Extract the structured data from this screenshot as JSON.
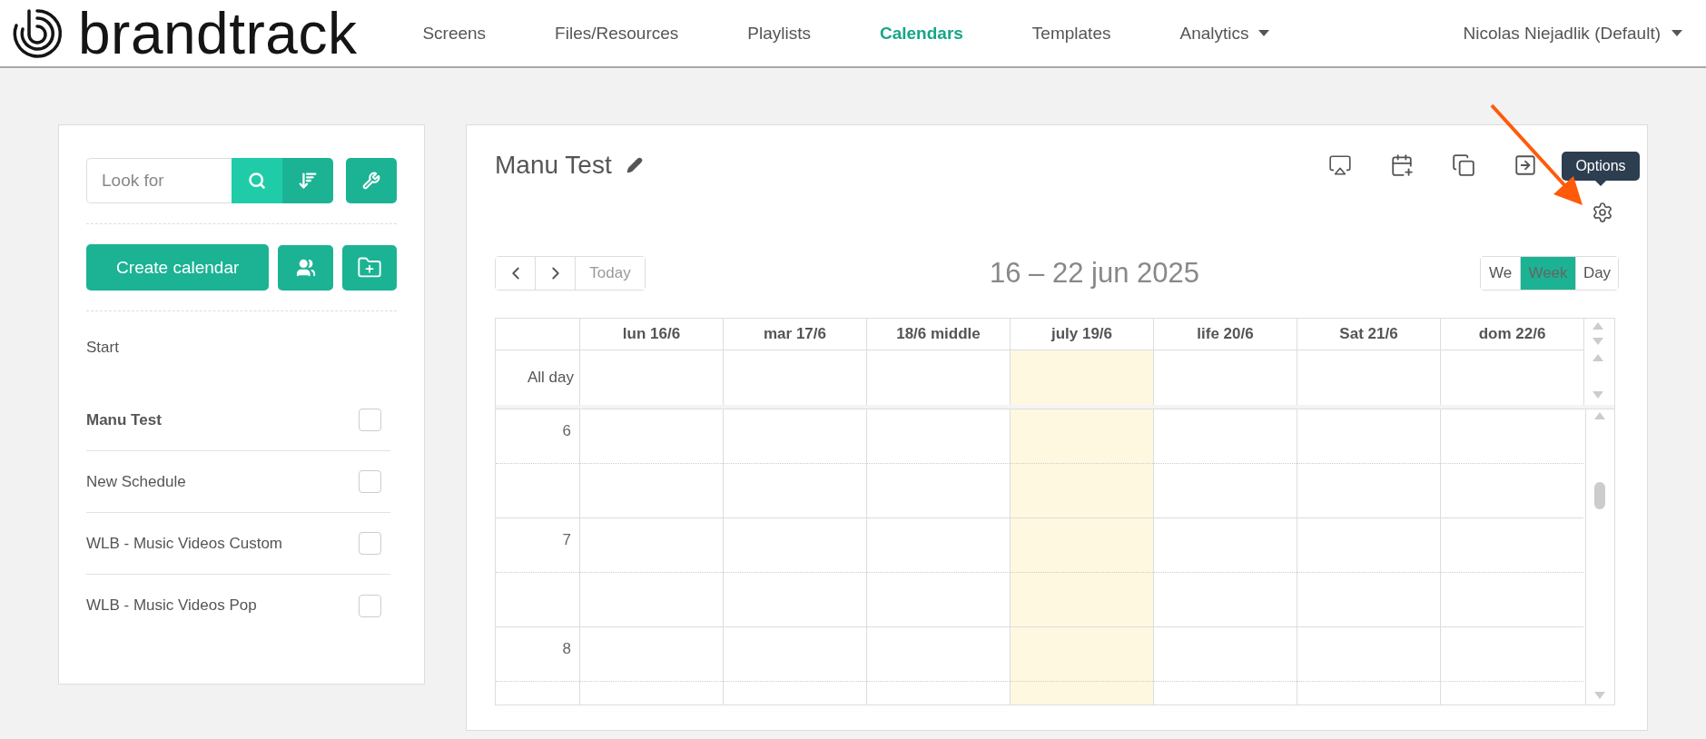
{
  "header": {
    "logo": "brandtrack",
    "nav": [
      {
        "label": "Screens",
        "selected": false,
        "kind": "link"
      },
      {
        "label": "Files/Resources",
        "selected": false,
        "kind": "link"
      },
      {
        "label": "Playlists",
        "selected": false,
        "kind": "link"
      },
      {
        "label": "Calendars",
        "selected": true,
        "kind": "link"
      },
      {
        "label": "Templates",
        "selected": false,
        "kind": "link"
      },
      {
        "label": "Analytics",
        "selected": false,
        "kind": "dropdown"
      }
    ],
    "user": "Nicolas Niejadlik (Default)"
  },
  "sidebar": {
    "search": {
      "placeholder": "Look for"
    },
    "create_button": "Create calendar",
    "section": "Start",
    "calendars": [
      {
        "name": "Manu Test",
        "selected": true,
        "checked": false
      },
      {
        "name": "New Schedule",
        "selected": false,
        "checked": false
      },
      {
        "name": "WLB - Music Videos Custom",
        "selected": false,
        "checked": false
      },
      {
        "name": "WLB - Music Videos Pop",
        "selected": false,
        "checked": false
      }
    ]
  },
  "calendar": {
    "title": "Manu Test",
    "tooltip": "Options",
    "today_button": "Today",
    "range": "16 – 22 jun 2025",
    "views": [
      {
        "label": "We",
        "selected": false
      },
      {
        "label": "Week",
        "selected": true
      },
      {
        "label": "Day",
        "selected": false
      }
    ],
    "columns": [
      {
        "label": "lun 16/6",
        "today": false
      },
      {
        "label": "mar 17/6",
        "today": false
      },
      {
        "label": "18/6 middle",
        "today": false
      },
      {
        "label": "july 19/6",
        "today": true
      },
      {
        "label": "life 20/6",
        "today": false
      },
      {
        "label": "Sat 21/6",
        "today": false
      },
      {
        "label": "dom 22/6",
        "today": false
      }
    ],
    "all_day_label": "All day",
    "hours": [
      "6",
      "7",
      "8"
    ]
  }
}
